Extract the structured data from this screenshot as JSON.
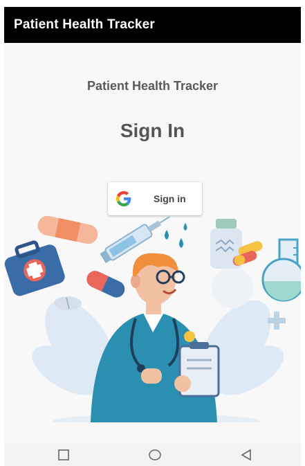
{
  "app_bar": {
    "title": "Patient Health Tracker"
  },
  "content": {
    "subtitle": "Patient Health Tracker",
    "heading": "Sign In",
    "google_button": {
      "label": "Sign in",
      "icon": "google-g-icon"
    }
  },
  "illustration": {
    "description_icon": "doctor-medical-illustration"
  },
  "nav_bar": {
    "items": [
      {
        "icon": "recents-square-icon"
      },
      {
        "icon": "home-circle-icon"
      },
      {
        "icon": "back-triangle-icon"
      }
    ]
  },
  "colors": {
    "app_bar": "#000000",
    "background": "#f8f8f8",
    "accent_blue": "#2a8fb0",
    "google_blue": "#4285F4",
    "google_red": "#EA4335",
    "google_yellow": "#FBBC05",
    "google_green": "#34A853"
  }
}
